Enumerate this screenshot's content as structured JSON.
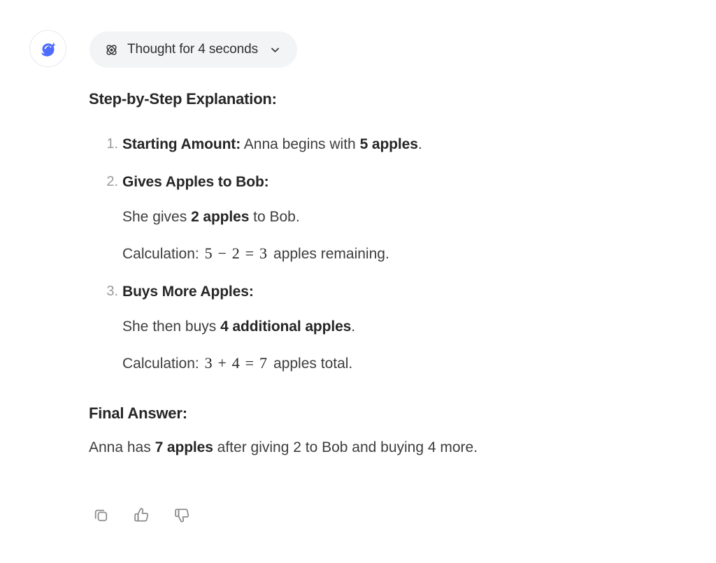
{
  "avatar": {
    "icon": "deepseek-whale-logo",
    "color": "#4d6bfe"
  },
  "thought": {
    "icon": "atom-icon",
    "label": "Thought for 4 seconds",
    "chevron_icon": "chevron-down-icon",
    "background": "#f3f4f6"
  },
  "content": {
    "heading": "Step-by-Step Explanation:",
    "steps": [
      {
        "number": "1.",
        "title": "Starting Amount:",
        "rest_before_bold": " Anna begins with ",
        "bold_value": "5 apples",
        "rest_after_bold": ".",
        "sublines": []
      },
      {
        "number": "2.",
        "title": "Gives Apples to Bob:",
        "rest_before_bold": "",
        "bold_value": "",
        "rest_after_bold": "",
        "sublines": [
          {
            "prefix": "She gives ",
            "bold": "2 apples",
            "suffix": " to Bob.",
            "math": null
          },
          {
            "prefix": "Calculation: ",
            "bold": "",
            "suffix": " apples remaining.",
            "math": "5 − 2 = 3"
          }
        ]
      },
      {
        "number": "3.",
        "title": "Buys More Apples:",
        "rest_before_bold": "",
        "bold_value": "",
        "rest_after_bold": "",
        "sublines": [
          {
            "prefix": "She then buys ",
            "bold": "4 additional apples",
            "suffix": ".",
            "math": null
          },
          {
            "prefix": "Calculation: ",
            "bold": "",
            "suffix": " apples total.",
            "math": "3 + 4 = 7"
          }
        ]
      }
    ],
    "final_heading": "Final Answer:",
    "final_answer": {
      "prefix": "Anna has ",
      "bold": "7 apples",
      "suffix": " after giving 2 to Bob and buying 4 more."
    }
  },
  "actions": [
    {
      "name": "copy-button",
      "icon": "copy-icon"
    },
    {
      "name": "thumbs-up-button",
      "icon": "thumbs-up-icon"
    },
    {
      "name": "thumbs-down-button",
      "icon": "thumbs-down-icon"
    }
  ]
}
